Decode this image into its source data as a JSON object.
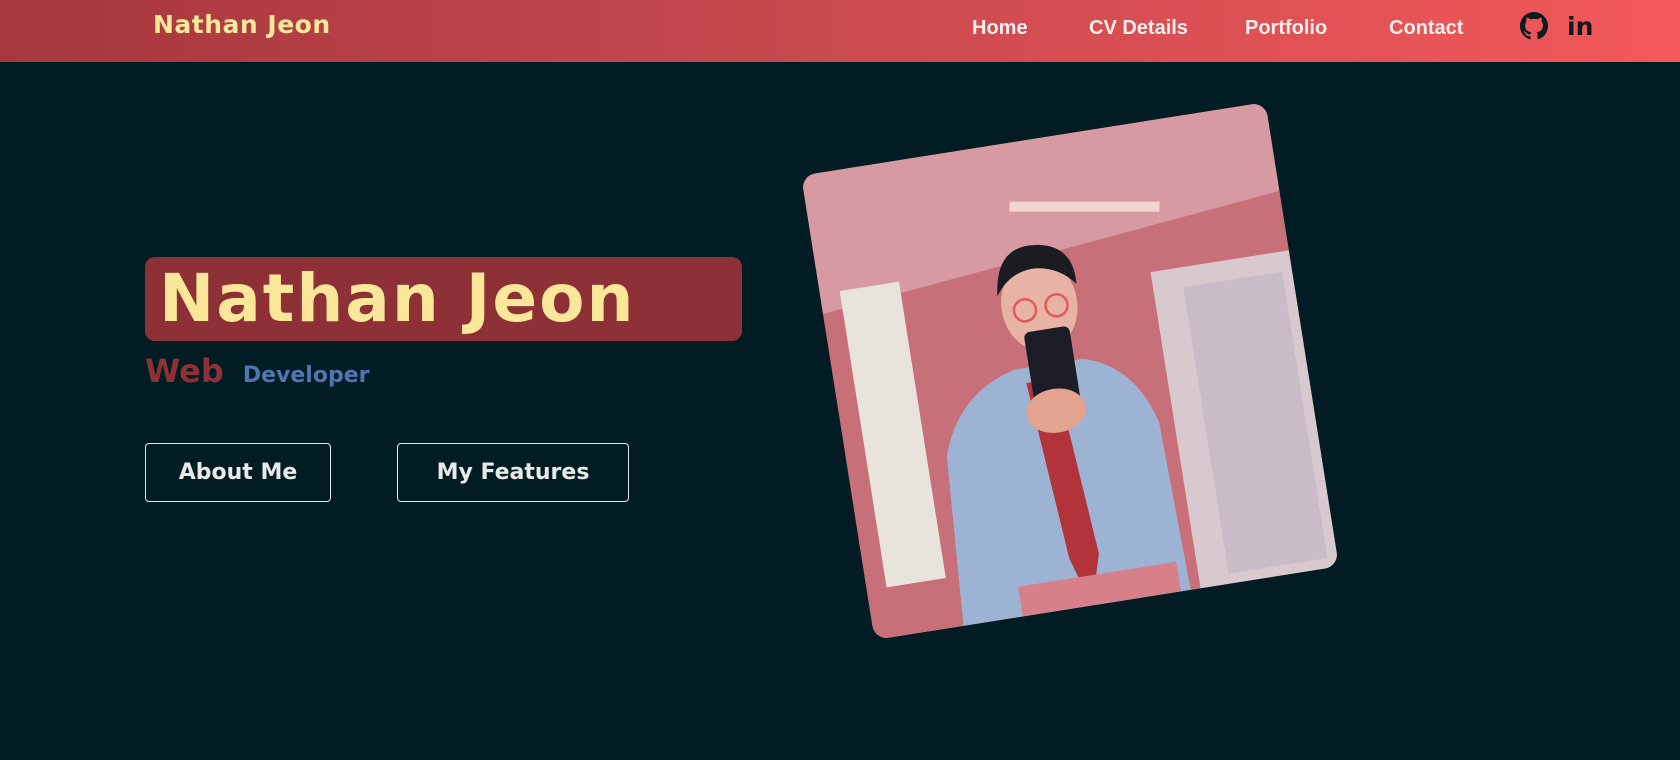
{
  "nav": {
    "brand": "Nathan Jeon",
    "links": [
      "Home",
      "CV Details",
      "Portfolio",
      "Contact"
    ],
    "icons": [
      "github-icon",
      "linkedin-icon"
    ],
    "linkedin_text": "in"
  },
  "hero": {
    "title": "Nathan Jeon",
    "subtitle_primary": "Web",
    "subtitle_secondary": "Developer",
    "buttons": [
      "About Me",
      "My Features"
    ]
  },
  "colors": {
    "background": "#021c24",
    "nav_gradient_start": "#a5373d",
    "nav_gradient_end": "#f4585a",
    "accent_yellow": "#fbe79a",
    "accent_red": "#8e3136",
    "accent_blue": "#4f76b2"
  }
}
